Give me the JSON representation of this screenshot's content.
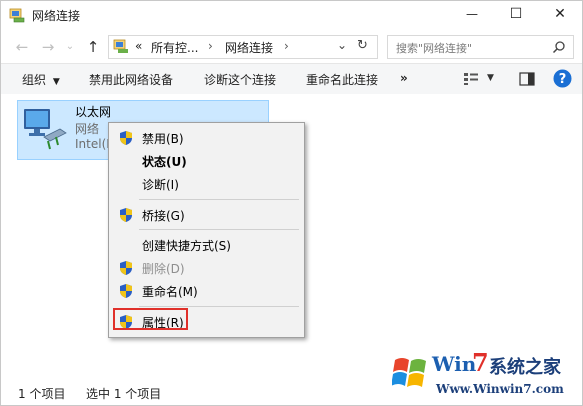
{
  "window": {
    "title": "网络连接",
    "controls": {
      "minimize": "—",
      "maximize": "☐",
      "close": "✕"
    }
  },
  "nav": {
    "back_icon": "left-arrow-icon",
    "forward_icon": "right-arrow-icon",
    "up_icon": "up-arrow-icon",
    "address": {
      "prefix": "«",
      "crumbs": [
        "所有控...",
        "网络连接"
      ],
      "separator": "›"
    },
    "search_placeholder": "搜索\"网络连接\""
  },
  "toolbar": {
    "organize": "组织",
    "disable_device": "禁用此网络设备",
    "diagnose": "诊断这个连接",
    "rename": "重命名此连接",
    "more": "»"
  },
  "adapter": {
    "name": "以太网",
    "line1": "网络",
    "line2": "Intel(I"
  },
  "context_menu": {
    "items": [
      {
        "label": "禁用(B)",
        "shield": true
      },
      {
        "label": "状态(U)",
        "bold": true
      },
      {
        "label": "诊断(I)"
      },
      {
        "label": "桥接(G)",
        "shield": true
      },
      {
        "label": "创建快捷方式(S)"
      },
      {
        "label": "删除(D)",
        "shield": true,
        "disabled": true
      },
      {
        "label": "重命名(M)",
        "shield": true
      },
      {
        "label": "属性(R)",
        "shield": true
      }
    ]
  },
  "status": {
    "count": "1 个项目",
    "selected": "选中 1 个项目"
  },
  "watermark": {
    "brand_win": "Win",
    "brand_seven": "7",
    "brand_cn": "系统之家",
    "url": "Www.Winwin7.com"
  },
  "colors": {
    "selection": "#cce8ff",
    "highlight_border": "#e0302a",
    "help": "#1a6fd4"
  }
}
